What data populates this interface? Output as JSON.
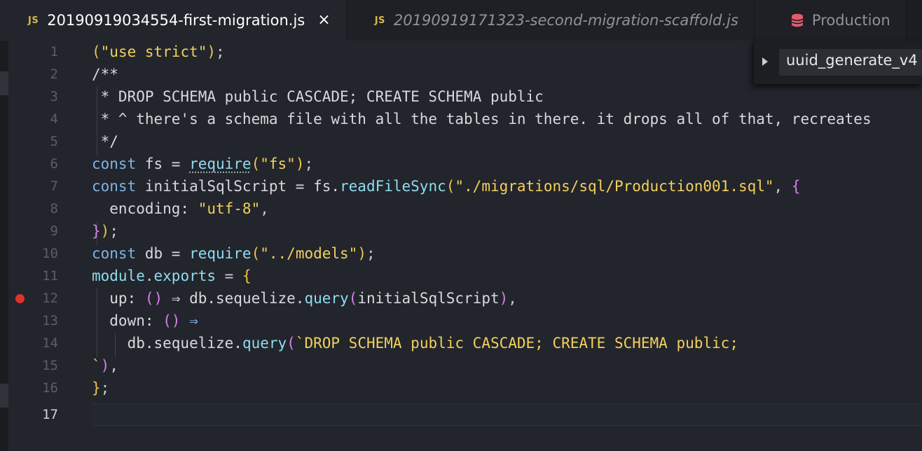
{
  "tabs": [
    {
      "icon": "JS",
      "label": "20190919034554-first-migration.js",
      "close": "×",
      "active": true
    },
    {
      "icon": "JS",
      "label": "20190919171323-second-migration-scaffold.js",
      "active": false
    },
    {
      "label": "Production",
      "active": false
    }
  ],
  "popup": {
    "label": "uuid_generate_v4"
  },
  "editor": {
    "line_numbers": [
      "1",
      "2",
      "3",
      "4",
      "5",
      "6",
      "7",
      "8",
      "9",
      "10",
      "11",
      "12",
      "13",
      "14",
      "15",
      "16",
      "17"
    ],
    "current_line": "17",
    "breakpoint_line": "12",
    "tokens": {
      "l1": [
        "(",
        "\"use strict\"",
        ")",
        ";"
      ],
      "l2": [
        "/**"
      ],
      "l3": [
        " * DROP SCHEMA public CASCADE; CREATE SCHEMA public"
      ],
      "l4": [
        " * ^ there's a schema file with all the tables in there. it drops all of that, recreates"
      ],
      "l5": [
        " */"
      ],
      "l6": [
        "const",
        " fs = ",
        "require",
        "(",
        "\"fs\"",
        ")",
        ";"
      ],
      "l7": [
        "const",
        " initialSqlScript = fs.",
        "readFileSync",
        "(",
        "\"./migrations/sql/Production001.sql\"",
        ", ",
        "{"
      ],
      "l8": [
        "  encoding: ",
        "\"utf-8\"",
        ","
      ],
      "l9": [
        "}",
        ")",
        ";"
      ],
      "l10": [
        "const",
        " db = ",
        "require",
        "(",
        "\"../models\"",
        ")",
        ";"
      ],
      "l11": [
        "module",
        ".",
        "exports",
        " = ",
        "{"
      ],
      "l12": [
        "  up: ",
        "()",
        " ⇒ db.sequelize.",
        "query",
        "(",
        "initialSqlScript",
        ")",
        ","
      ],
      "l13": [
        "  down: ",
        "()",
        " ⇒"
      ],
      "l14": [
        "    db.sequelize.",
        "query",
        "(",
        "`DROP SCHEMA public CASCADE; CREATE SCHEMA public;"
      ],
      "l15": [
        "`",
        ")",
        ","
      ],
      "l16": [
        "}",
        ";"
      ],
      "l17": [
        ""
      ]
    }
  },
  "colors": {
    "background": "#22252b",
    "keyword": "#7fb3e8",
    "string": "#f3cf5e",
    "comment": "#94b86b",
    "function": "#8fdcf2",
    "bracket": "#f0c34b",
    "paren_nested": "#d680ec",
    "breakpoint": "#e0312d"
  },
  "icons": {
    "tab1": "js-file-icon",
    "tab2": "js-file-icon",
    "tab3": "database-icon",
    "close": "close-icon",
    "popup": "chevron-right-icon",
    "breakpoint": "breakpoint-icon"
  }
}
